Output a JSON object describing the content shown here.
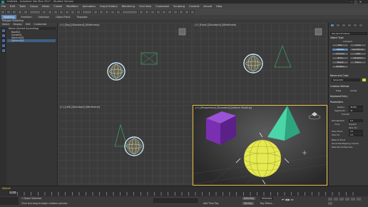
{
  "titlebar": {
    "title": "Untitled - Autodesk 3ds Max 2017 - Student Version"
  },
  "menubar": {
    "items": [
      "File",
      "Edit",
      "Tools",
      "Group",
      "Views",
      "Create",
      "Modifiers",
      "Animation",
      "Graph Editors",
      "Rendering",
      "Civil View",
      "Customize",
      "Scripting",
      "Content",
      "Arnold",
      "Help"
    ]
  },
  "ribbon": {
    "tabs": [
      "Modeling",
      "Freeform",
      "Selection",
      "Object Paint",
      "Populate"
    ],
    "subtitle": "Polygon Modeling"
  },
  "scene_explorer": {
    "tabs": [
      "Select",
      "Display",
      "Edit",
      "Customize"
    ],
    "header": "Name (Sorted Ascending)",
    "items": [
      "Box001",
      "Cone001",
      "Sphere001",
      "Sphere002"
    ]
  },
  "viewports": {
    "top": "[+] [Top] [Standard] [Wireframe]",
    "front": "[+] [Front] [Standard] [Wireframe]",
    "left": "[+] [Left] [Standard] [Wireframe]",
    "perspective": "[+] [Perspective] [Standard] [Default Shading]"
  },
  "command_panel": {
    "dropdown": "Standard Primitives",
    "object_type_title": "Object Type",
    "autogrid": "AutoGrid",
    "buttons": [
      "Box",
      "Cone",
      "Sphere",
      "GeoSphere",
      "Cylinder",
      "Tube",
      "Torus",
      "Pyramid",
      "Teapot",
      "Plane",
      "TextPlus"
    ],
    "name_color_title": "Name and Color",
    "name_value": "Sphere002",
    "creation_title": "Creation Method",
    "edge": "Edge",
    "center": "Center",
    "keyboard_title": "Keyboard Entry",
    "params_title": "Parameters",
    "radius_label": "Radius:",
    "radius_value": "38.892",
    "segments_label": "Segments:",
    "segments_value": "32",
    "smooth": "Smooth",
    "hemisphere_label": "Hemisphere:",
    "hemisphere_value": "0.0",
    "chop": "Chop",
    "squash": "Squash",
    "slice_on": "Slice On",
    "slice_from_label": "Slice From:",
    "slice_from_value": "0.0",
    "slice_to_label": "Slice To:",
    "slice_to_value": "0.0",
    "base_to_pivot": "Base To Pivot",
    "gen_map": "Generate Mapping Coords.",
    "real_world": "Real-World Map Size"
  },
  "timeline": {
    "frame": "0 / 100",
    "layer": "Default"
  },
  "status": {
    "selected": "1 Object Selected",
    "hint": "Click and drag to begin creation process",
    "add_time_tag": "Add Time Tag",
    "auto_key": "Auto Key",
    "selected_btn": "Selected",
    "set_key": "Set Key",
    "key_filters": "Key Filters..."
  },
  "colors": {
    "accent": "#5a86b8",
    "selection_outline": "#c8e8ff",
    "box": "#7a2fb0",
    "cone": "#3cc49a",
    "sphere": "#d8e04a"
  }
}
